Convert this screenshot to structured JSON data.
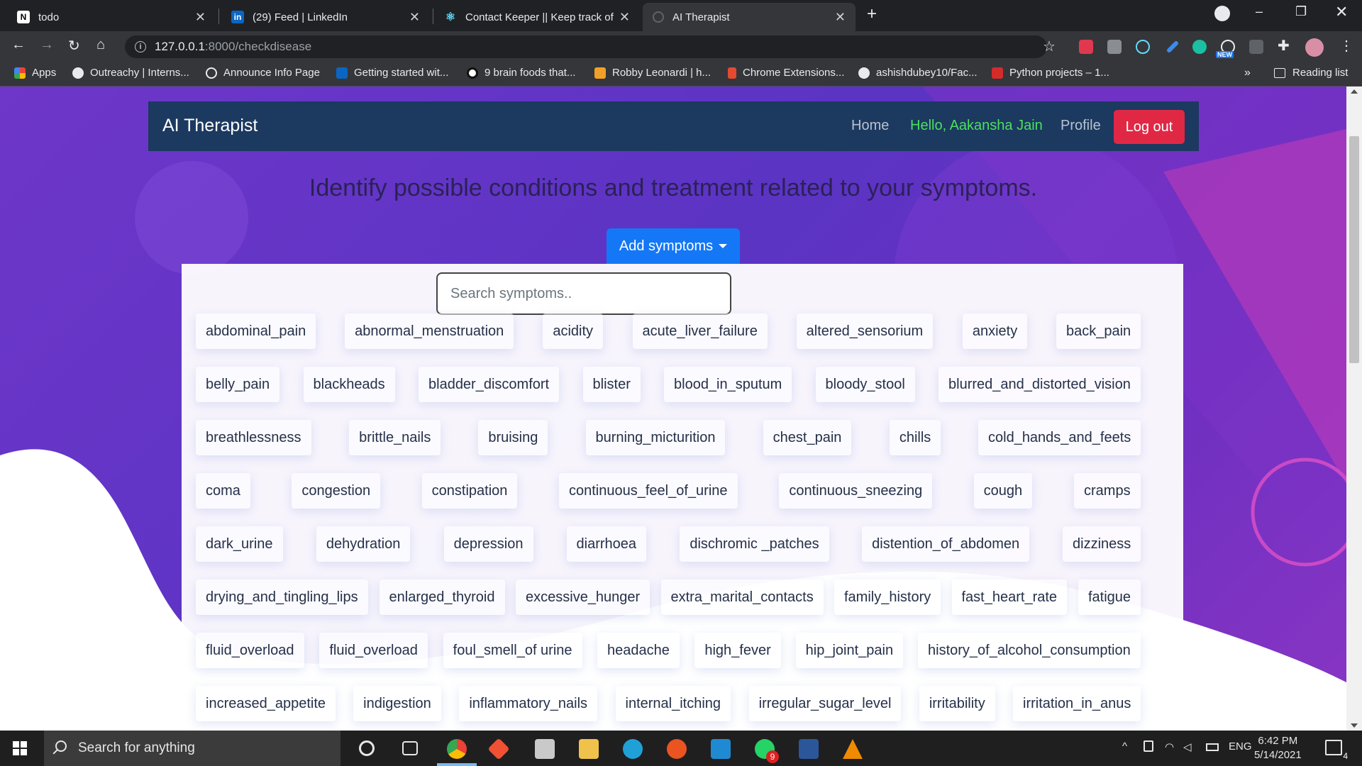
{
  "tabs": [
    {
      "title": "todo",
      "icon": "notion-icon",
      "color": "#ffffff"
    },
    {
      "title": "(29) Feed | LinkedIn",
      "icon": "linkedin-icon",
      "color": "#0a66c2"
    },
    {
      "title": "Contact Keeper || Keep track of y",
      "icon": "react-icon",
      "color": "#61dafb"
    },
    {
      "title": "AI Therapist",
      "icon": "globe-icon",
      "color": "#5f6368"
    }
  ],
  "address": {
    "host": "127.0.0.1",
    "path": ":8000/checkdisease"
  },
  "extension_badge": "NEW",
  "bookmarks": [
    {
      "label": "Apps",
      "color": "#ea4335"
    },
    {
      "label": "Outreachy | Interns...",
      "color": "#e8eaed"
    },
    {
      "label": "Announce Info Page",
      "color": "#e8eaed"
    },
    {
      "label": "Getting started wit...",
      "color": "#0a66c2"
    },
    {
      "label": "9 brain foods that...",
      "color": "#111111"
    },
    {
      "label": "Robby Leonardi | h...",
      "color": "#f0a028"
    },
    {
      "label": "Chrome Extensions...",
      "color": "#e34a2f"
    },
    {
      "label": "ashishdubey10/Fac...",
      "color": "#24292e"
    },
    {
      "label": "Python projects – 1...",
      "color": "#d62b2b"
    }
  ],
  "reading_list": "Reading list",
  "site": {
    "brand": "AI Therapist",
    "nav": {
      "home": "Home",
      "hello": "Hello, Aakansha Jain",
      "profile": "Profile",
      "logout": "Log out"
    },
    "headline": "Identify possible conditions and treatment related to your symptoms.",
    "add_button": "Add symptoms",
    "search_placeholder": "Search symptoms.."
  },
  "symptom_rows": [
    [
      "abdominal_pain",
      "abnormal_menstruation",
      "acidity",
      "acute_liver_failure",
      "altered_sensorium",
      "anxiety",
      "back_pain"
    ],
    [
      "belly_pain",
      "blackheads",
      "bladder_discomfort",
      "blister",
      "blood_in_sputum",
      "bloody_stool",
      "blurred_and_distorted_vision"
    ],
    [
      "breathlessness",
      "brittle_nails",
      "bruising",
      "burning_micturition",
      "chest_pain",
      "chills",
      "cold_hands_and_feets"
    ],
    [
      "coma",
      "congestion",
      "constipation",
      "continuous_feel_of_urine",
      "continuous_sneezing",
      "cough",
      "cramps"
    ],
    [
      "dark_urine",
      "dehydration",
      "depression",
      "diarrhoea",
      "dischromic _patches",
      "distention_of_abdomen",
      "dizziness"
    ],
    [
      "drying_and_tingling_lips",
      "enlarged_thyroid",
      "excessive_hunger",
      "extra_marital_contacts",
      "family_history",
      "fast_heart_rate",
      "fatigue"
    ],
    [
      "fluid_overload",
      "fluid_overload",
      "foul_smell_of urine",
      "headache",
      "high_fever",
      "hip_joint_pain",
      "history_of_alcohol_consumption"
    ],
    [
      "increased_appetite",
      "indigestion",
      "inflammatory_nails",
      "internal_itching",
      "irregular_sugar_level",
      "irritability",
      "irritation_in_anus"
    ]
  ],
  "taskbar": {
    "search_text": "Search for anything",
    "time": "6:42 PM",
    "date": "5/14/2021",
    "language": "ENG",
    "notification_count": "4",
    "whatsapp_badge": "9"
  }
}
